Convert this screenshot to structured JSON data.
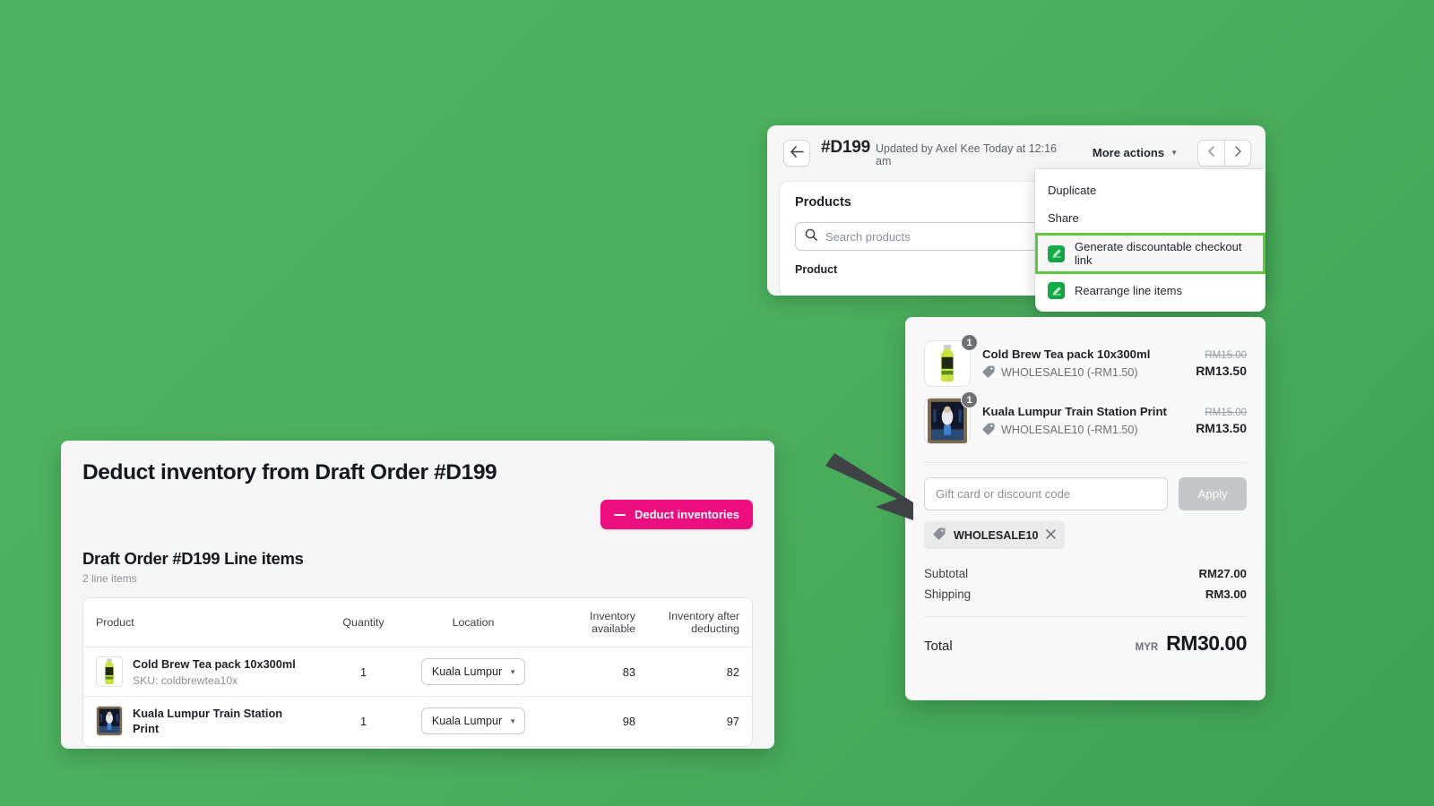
{
  "theme": {
    "background_green": "#4CB05E",
    "accent_pink": "#EC0D7E",
    "highlight_green": "#5EC83F",
    "app_icon_green": "#16B14B"
  },
  "order_window": {
    "back_icon": "arrow-left-icon",
    "order_id": "#D199",
    "updated_text": "Updated by Axel Kee Today at 12:16 am",
    "more_actions_label": "More actions",
    "prev_icon": "chevron-left-icon",
    "next_icon": "chevron-right-icon",
    "products_card": {
      "title": "Products",
      "search_placeholder": "Search products",
      "search_icon": "search-icon",
      "column_header": "Product"
    }
  },
  "actions_menu": {
    "items": [
      {
        "label": "Duplicate",
        "has_icon": false,
        "highlighted": false
      },
      {
        "label": "Share",
        "has_icon": false,
        "highlighted": false
      },
      {
        "label": "Generate discountable checkout link",
        "has_icon": true,
        "highlighted": true
      },
      {
        "label": "Rearrange line items",
        "has_icon": true,
        "highlighted": false
      }
    ]
  },
  "deduct_panel": {
    "title": "Deduct inventory from Draft Order #D199",
    "action_button": {
      "label": "Deduct inventories",
      "icon": "minus-icon"
    },
    "section_title": "Draft Order #D199 Line items",
    "section_count": "2 line items",
    "table": {
      "headers": [
        "Product",
        "Quantity",
        "Location",
        "Inventory available",
        "Inventory after deducting"
      ],
      "header_avail_line1": "Inventory",
      "header_avail_line2": "available",
      "header_after_line1": "Inventory after",
      "header_after_line2": "deducting",
      "rows": [
        {
          "product_name": "Cold Brew Tea pack 10x300ml",
          "sku": "SKU: coldbrewtea10x",
          "thumb": "bottle-thumbnail",
          "quantity": "1",
          "location": "Kuala Lumpur",
          "inventory_available": "83",
          "inventory_after": "82"
        },
        {
          "product_name": "Kuala Lumpur Train Station Print",
          "sku": "",
          "thumb": "print-thumbnail",
          "quantity": "1",
          "location": "Kuala Lumpur",
          "inventory_available": "98",
          "inventory_after": "97"
        }
      ]
    }
  },
  "cart_panel": {
    "items": [
      {
        "name": "Cold Brew Tea pack 10x300ml",
        "qty_badge": "1",
        "discount_label": "WHOLESALE10 (-RM1.50)",
        "price_original": "RM15.00",
        "price_final": "RM13.50",
        "thumb": "bottle-thumbnail",
        "tag_icon": "price-tag-icon"
      },
      {
        "name": "Kuala Lumpur Train Station Print",
        "qty_badge": "1",
        "discount_label": "WHOLESALE10 (-RM1.50)",
        "price_original": "RM15.00",
        "price_final": "RM13.50",
        "thumb": "print-thumbnail",
        "tag_icon": "price-tag-icon"
      }
    ],
    "discount_input_placeholder": "Gift card or discount code",
    "apply_label": "Apply",
    "applied_code": "WHOLESALE10",
    "remove_code_icon": "close-icon",
    "totals": [
      {
        "label": "Subtotal",
        "value": "RM27.00"
      },
      {
        "label": "Shipping",
        "value": "RM3.00"
      }
    ],
    "grand_total": {
      "label": "Total",
      "currency": "MYR",
      "value": "RM30.00"
    }
  },
  "annotation": {
    "arrow": "pointer-arrow-down-right"
  }
}
